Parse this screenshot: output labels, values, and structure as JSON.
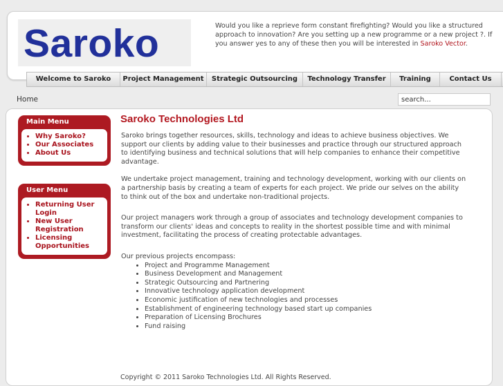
{
  "logo": {
    "text": "Saroko"
  },
  "intro": {
    "text": "Would you like a reprieve form constant firefighting?  Would you like a structured approach to innovation?  Are you setting up a new programme or a new project ?. If you answer yes to any of these then you will be interested in ",
    "link": "Saroko Vector",
    "end": "."
  },
  "nav": {
    "items": [
      "Welcome to Saroko",
      "Project Management",
      "Strategic Outsourcing",
      "Technology Transfer",
      "Training",
      "Contact Us"
    ]
  },
  "breadcrumb": "Home",
  "search": {
    "value": "search..."
  },
  "main_menu": {
    "title": "Main Menu",
    "items": [
      "Why Saroko?",
      "Our Associates",
      "About Us"
    ]
  },
  "user_menu": {
    "title": "User Menu",
    "items": [
      "Returning User Login",
      "New User Registration",
      "Licensing Opportunities"
    ]
  },
  "content": {
    "title": "Saroko Technologies Ltd",
    "paragraphs": [
      "Saroko brings together resources, skills, technology and ideas to achieve business objectives. We support our clients by adding value to their businesses and practice through our structured approach to identifying business and technical solutions that will help companies to enhance their competitive advantage.",
      "We undertake project management, training and technology development,  working with our clients on a partnership basis by creating a team of experts for each project. We pride our selves on the ability to think out of the box and undertake non-traditional projects.",
      "Our project managers work through a group of associates and technology development companies to transform our clients' ideas and concepts to reality in the shortest possible time and with minimal investment, facilitating the process of creating protectable advantages.",
      "Our previous projects encompass:"
    ],
    "projects": [
      "Project and Programme Management",
      "Business Development and Management",
      "Strategic Outsourcing and Partnering",
      "Innovative technology application development",
      "Economic justification of new technologies and processes",
      "Establishment of engineering technology based start up companies",
      "Preparation of Licensing Brochures",
      "Fund raising"
    ]
  },
  "footer": "Copyright © 2011 Saroko Technologies Ltd. All Rights Reserved."
}
